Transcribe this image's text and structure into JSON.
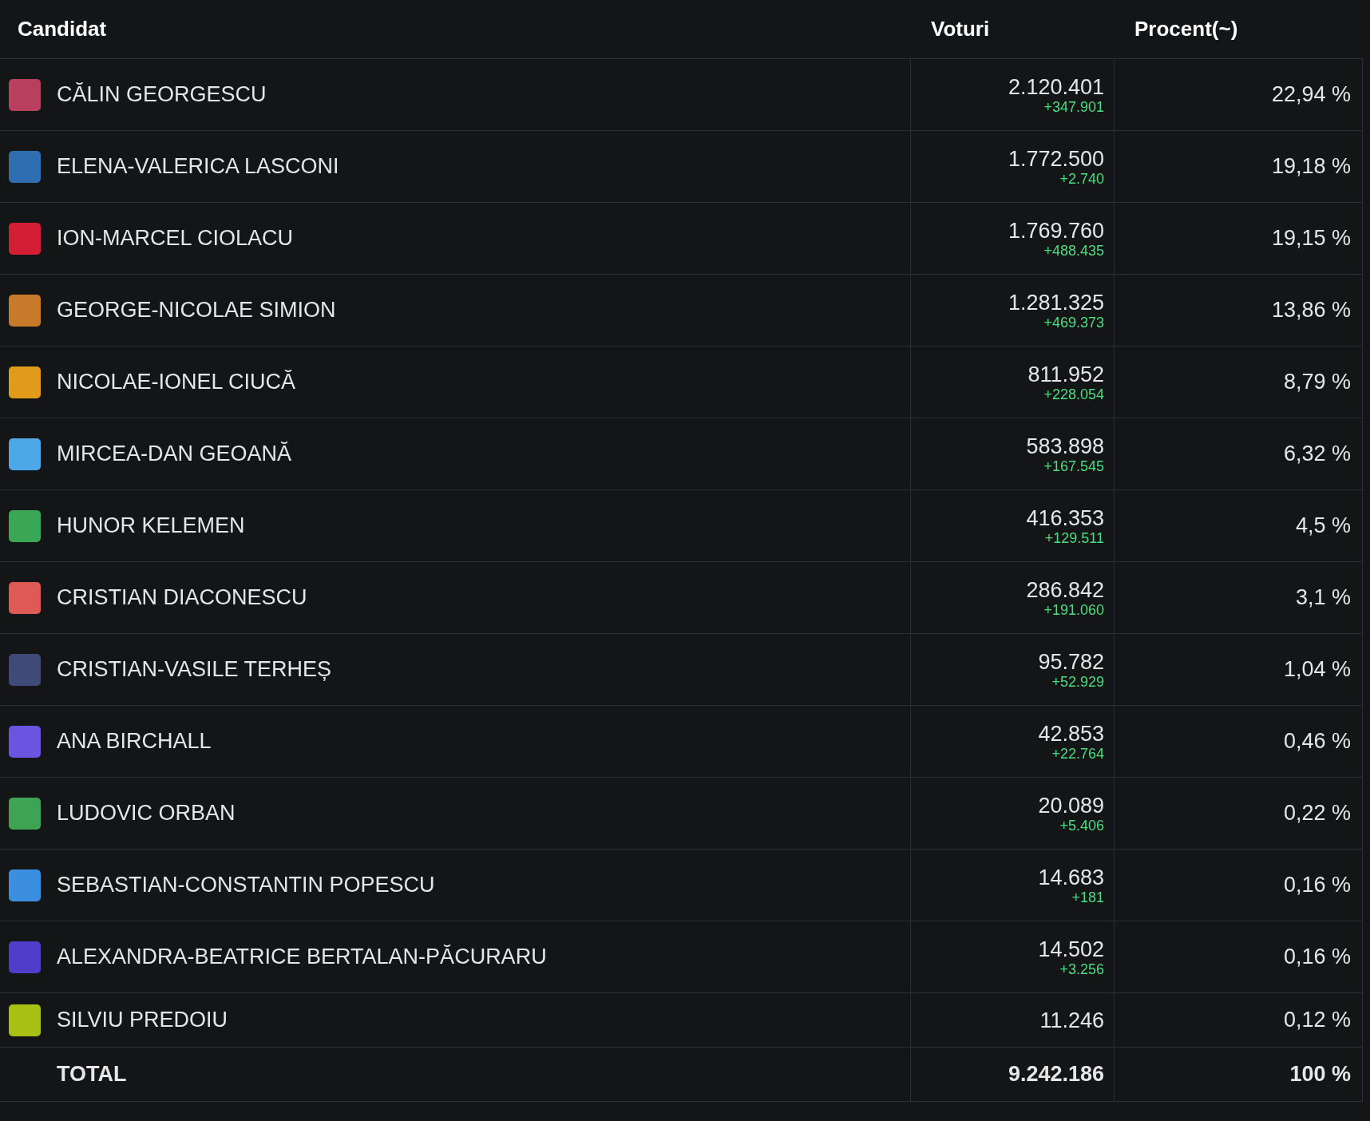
{
  "table": {
    "columns": [
      "Candidat",
      "Voturi",
      "Procent(~)"
    ],
    "rows": [
      {
        "name": "CĂLIN GEORGESCU",
        "color": "#b8405e",
        "votes": "2.120.401",
        "delta": "+347.901",
        "percent": "22,94 %"
      },
      {
        "name": "ELENA-VALERICA LASCONI",
        "color": "#2f6eb0",
        "votes": "1.772.500",
        "delta": "+2.740",
        "percent": "19,18 %"
      },
      {
        "name": "ION-MARCEL CIOLACU",
        "color": "#d41e35",
        "votes": "1.769.760",
        "delta": "+488.435",
        "percent": "19,15 %"
      },
      {
        "name": "GEORGE-NICOLAE SIMION",
        "color": "#c67a2a",
        "votes": "1.281.325",
        "delta": "+469.373",
        "percent": "13,86 %"
      },
      {
        "name": "NICOLAE-IONEL CIUCĂ",
        "color": "#e19b1a",
        "votes": "811.952",
        "delta": "+228.054",
        "percent": "8,79 %"
      },
      {
        "name": "MIRCEA-DAN GEOANĂ",
        "color": "#4ea8e8",
        "votes": "583.898",
        "delta": "+167.545",
        "percent": "6,32 %"
      },
      {
        "name": "HUNOR KELEMEN",
        "color": "#3aa757",
        "votes": "416.353",
        "delta": "+129.511",
        "percent": "4,5 %"
      },
      {
        "name": "CRISTIAN DIACONESCU",
        "color": "#e05a55",
        "votes": "286.842",
        "delta": "+191.060",
        "percent": "3,1 %"
      },
      {
        "name": "CRISTIAN-VASILE TERHEȘ",
        "color": "#404a78",
        "votes": "95.782",
        "delta": "+52.929",
        "percent": "1,04 %"
      },
      {
        "name": "ANA BIRCHALL",
        "color": "#6b55e0",
        "votes": "42.853",
        "delta": "+22.764",
        "percent": "0,46 %"
      },
      {
        "name": "LUDOVIC ORBAN",
        "color": "#3ea355",
        "votes": "20.089",
        "delta": "+5.406",
        "percent": "0,22 %"
      },
      {
        "name": "SEBASTIAN-CONSTANTIN POPESCU",
        "color": "#3b8ee0",
        "votes": "14.683",
        "delta": "+181",
        "percent": "0,16 %"
      },
      {
        "name": "ALEXANDRA-BEATRICE BERTALAN-PĂCURARU",
        "color": "#4f3cc9",
        "votes": "14.502",
        "delta": "+3.256",
        "percent": "0,16 %"
      },
      {
        "name": "SILVIU PREDOIU",
        "color": "#a8c014",
        "votes": "11.246",
        "percent": "0,12 %"
      }
    ],
    "total": {
      "label": "TOTAL",
      "votes": "9.242.186",
      "percent": "100 %"
    }
  }
}
